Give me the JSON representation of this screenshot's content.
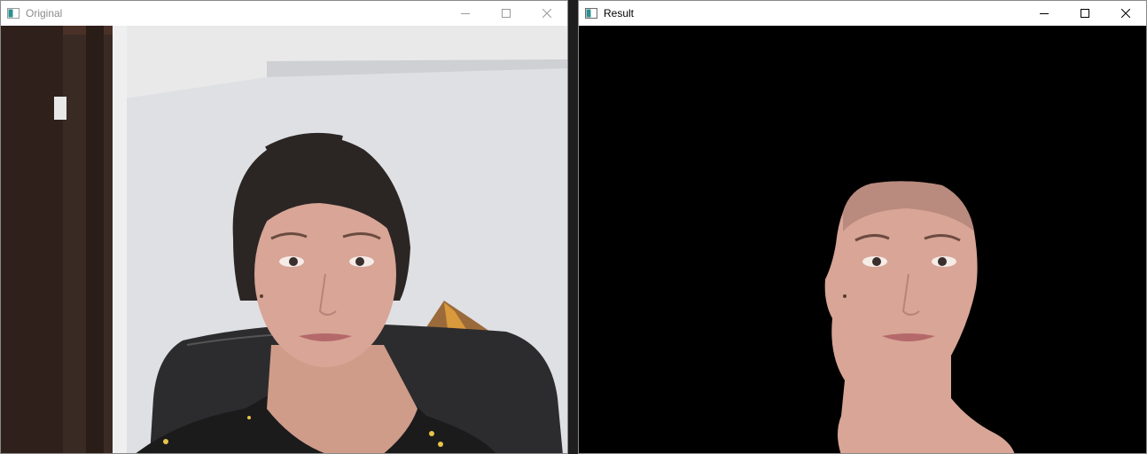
{
  "windows": {
    "original": {
      "title": "Original",
      "controls": [
        "minimize-icon",
        "maximize-icon",
        "close-icon"
      ]
    },
    "result": {
      "title": "Result",
      "controls": [
        "minimize-icon",
        "maximize-icon",
        "close-icon"
      ]
    }
  },
  "icons": {
    "app": "window-app-icon",
    "minimize": "minimize-icon",
    "maximize": "maximize-icon",
    "close": "close-icon"
  },
  "colors": {
    "wall": "#d9dadd",
    "door": "#3a2a22",
    "chair": "#2c2c2e",
    "hair": "#2b2624",
    "skin": "#d8a596",
    "result_background": "#000000",
    "inactive_title": "#8c8c8c"
  }
}
